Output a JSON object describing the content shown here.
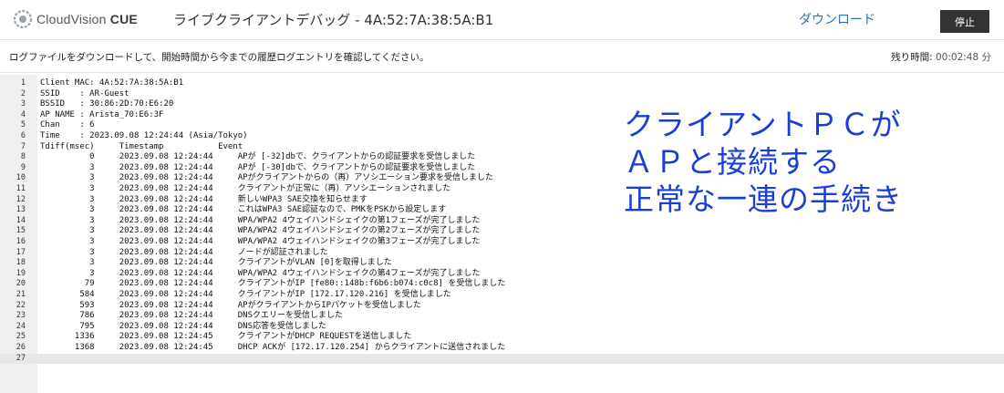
{
  "header": {
    "logo_brand": "CloudVision",
    "logo_product": "CUE",
    "title": "ライブクライアントデバッグ - 4A:52:7A:38:5A:B1",
    "download_label": "ダウンロード",
    "stop_label": "停止"
  },
  "infobar": {
    "description": "ログファイルをダウンロードして、開始時間から今までの履歴ログエントリを確認してください。",
    "remaining_label": "残り時間:",
    "remaining_value": "00:02:48 分"
  },
  "log_lines": [
    {
      "n": "1",
      "text": "Client MAC: 4A:52:7A:38:5A:B1"
    },
    {
      "n": "2",
      "text": "SSID    : AR-Guest"
    },
    {
      "n": "3",
      "text": "BSSID   : 30:86:2D:70:E6:20"
    },
    {
      "n": "4",
      "text": "AP NAME : Arista_70:E6:3F"
    },
    {
      "n": "5",
      "text": "Chan    : 6"
    },
    {
      "n": "6",
      "text": "Time    : 2023.09.08 12:24:44 (Asia/Tokyo)"
    },
    {
      "n": "7",
      "text": "Tdiff(msec)     Timestamp           Event"
    },
    {
      "n": "8",
      "text": "          0     2023.09.08 12:24:44     APが [-32]dbで、クライアントからの認証要求を受信しました"
    },
    {
      "n": "9",
      "text": "          3     2023.09.08 12:24:44     APが [-30]dbで、クライアントからの認証要求を受信しました"
    },
    {
      "n": "10",
      "text": "          3     2023.09.08 12:24:44     APがクライアントからの（再）アソシエーション要求を受信しました"
    },
    {
      "n": "11",
      "text": "          3     2023.09.08 12:24:44     クライアントが正常に（再）アソシエーションされました"
    },
    {
      "n": "12",
      "text": "          3     2023.09.08 12:24:44     新しいWPA3 SAE交換を知らせます"
    },
    {
      "n": "13",
      "text": "          3     2023.09.08 12:24:44     これはWPA3 SAE認証なので、PMKをPSKから設定します"
    },
    {
      "n": "14",
      "text": "          3     2023.09.08 12:24:44     WPA/WPA2 4ウェイハンドシェイクの第1フェーズが完了しました"
    },
    {
      "n": "15",
      "text": "          3     2023.09.08 12:24:44     WPA/WPA2 4ウェイハンドシェイクの第2フェーズが完了しました"
    },
    {
      "n": "16",
      "text": "          3     2023.09.08 12:24:44     WPA/WPA2 4ウェイハンドシェイクの第3フェーズが完了しました"
    },
    {
      "n": "17",
      "text": "          3     2023.09.08 12:24:44     ノードが認証されました"
    },
    {
      "n": "18",
      "text": "          3     2023.09.08 12:24:44     クライアントがVLAN [0]を取得しました"
    },
    {
      "n": "19",
      "text": "          3     2023.09.08 12:24:44     WPA/WPA2 4ウェイハンドシェイクの第4フェーズが完了しました"
    },
    {
      "n": "20",
      "text": "         79     2023.09.08 12:24:44     クライアントがIP [fe80::148b:f6b6:b074:c0c8] を受信しました"
    },
    {
      "n": "21",
      "text": "        584     2023.09.08 12:24:44     クライアントがIP [172.17.120.216] を受信しました"
    },
    {
      "n": "22",
      "text": "        593     2023.09.08 12:24:44     APがクライアントからIPパケットを受信しました"
    },
    {
      "n": "23",
      "text": "        786     2023.09.08 12:24:44     DNSクエリーを受信しました"
    },
    {
      "n": "24",
      "text": "        795     2023.09.08 12:24:44     DNS応答を受信しました"
    },
    {
      "n": "25",
      "text": "       1336     2023.09.08 12:24:45     クライアントがDHCP REQUESTを送信しました"
    },
    {
      "n": "26",
      "text": "       1368     2023.09.08 12:24:45     DHCP ACKが [172.17.120.254] からクライアントに送信されました"
    },
    {
      "n": "27",
      "text": ""
    }
  ],
  "overlay": {
    "line1": "クライアントＰＣが",
    "line2": "ＡＰと接続する",
    "line3": "正常な一連の手続き"
  },
  "colors": {
    "overlay_text": "#1a3fd6",
    "link": "#2d6fb8",
    "stop_button_bg": "#333333"
  },
  "icons": {
    "logo": "cloudvision-logo-icon"
  }
}
